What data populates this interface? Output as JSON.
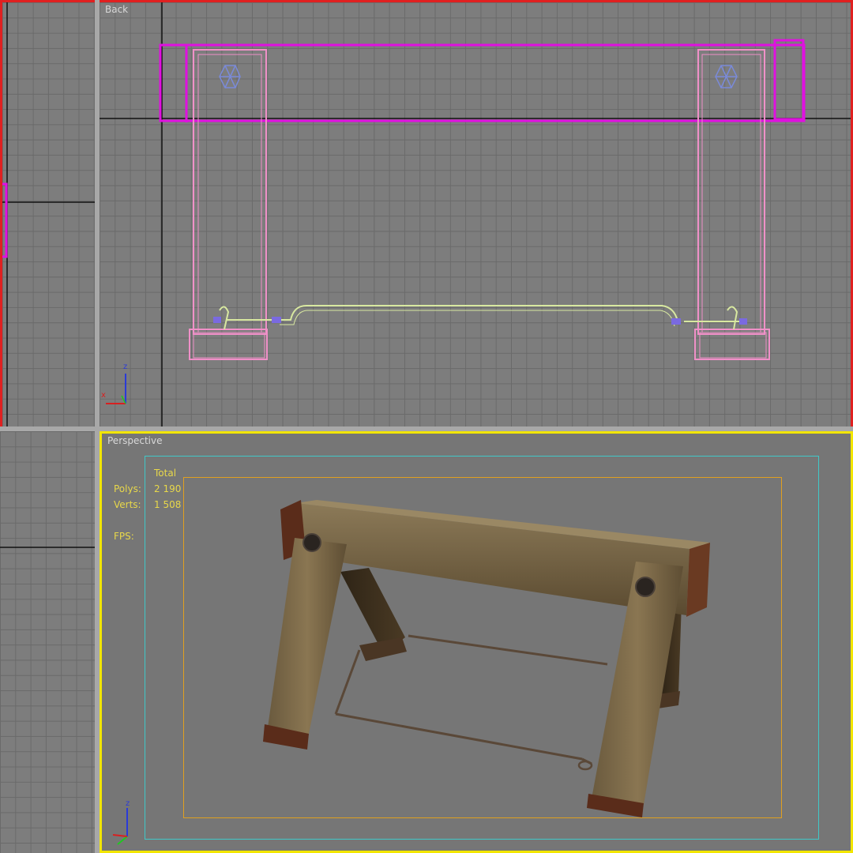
{
  "viewports": {
    "back": {
      "label": "Back"
    },
    "perspective": {
      "label": "Perspective"
    }
  },
  "stats": {
    "header": "Total",
    "polys_label": "Polys:",
    "polys_value": "2 190",
    "verts_label": "Verts:",
    "verts_value": "1 508",
    "fps_label": "FPS:"
  },
  "axis": {
    "x": "x",
    "z": "z"
  },
  "colors": {
    "active_border": "#f2e600",
    "frame_border": "#e02020",
    "wire_selected": "#e010e0",
    "wire_mesh": "#f090c8",
    "wire_rope": "#d8e8a0",
    "safe_frame_outer": "#40c8c8",
    "safe_frame_inner": "#e0a020"
  }
}
